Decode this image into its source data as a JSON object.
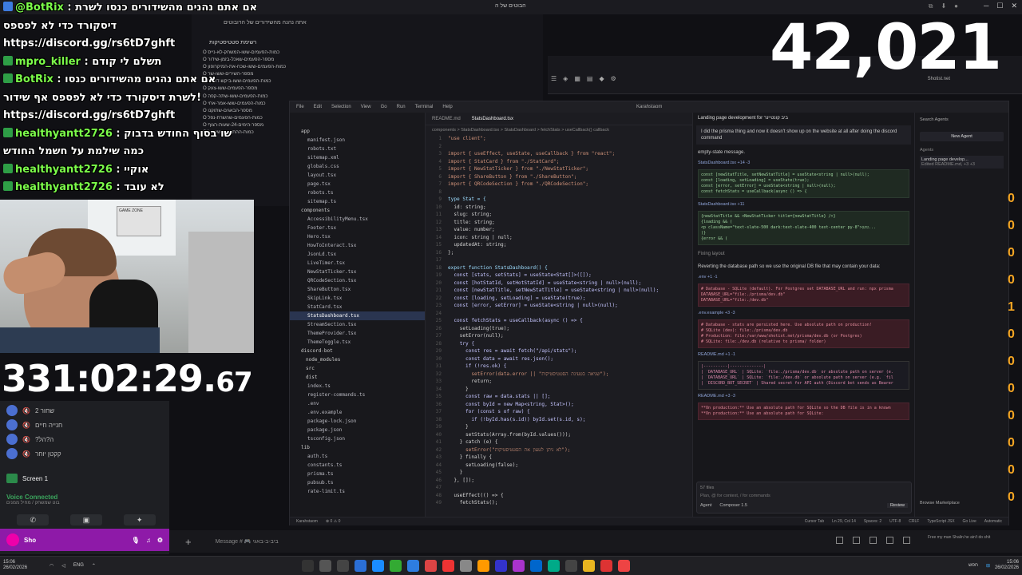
{
  "viewer_count": "42,021",
  "timer": {
    "main": "331:02:29.",
    "ms": "67"
  },
  "browser_top": {
    "title": "הבוטים של ה",
    "right_label": "Shotist.net"
  },
  "chat": [
    {
      "name": "@BotRix",
      "text": ": אם אתם נהנים מהשידורים כנסו לשרת",
      "badge": "blue"
    },
    {
      "name": "",
      "text": "דיסקורד כדי לא לפספס",
      "badge": "none"
    },
    {
      "name": "",
      "text": "https://discord.gg/rs6tD7ghft",
      "badge": "none"
    },
    {
      "name": "mpro_killer",
      "text": ": תשלם לי קודם",
      "badge": "green"
    },
    {
      "name": "BotRix",
      "text": ": אם אתם נהנים מהשידורים כנסו",
      "badge": "green"
    },
    {
      "name": "",
      "text": "לשרת דיסקורד כדי לא לפספס אף שידור!",
      "badge": "none"
    },
    {
      "name": "",
      "text": "https://discord.gg/rs6tD7ghft",
      "badge": "none"
    },
    {
      "name": "healthyantt2726",
      "text": ": שו בסוף החודש בדבוק",
      "badge": "green"
    },
    {
      "name": "",
      "text": "כמה שילמת על חשמל החודש",
      "badge": "none"
    },
    {
      "name": "healthyantt2726",
      "text": ": אוקיי",
      "badge": "green"
    },
    {
      "name": "healthyantt2726",
      "text": ": לא עובד",
      "badge": "green"
    }
  ],
  "bg_browser": {
    "tab": "אתה נהנה מהשידורים של הרובוטים",
    "title": "רשימת סטטיסטיקות",
    "items": [
      "כמות-הפעמים-ששו-המשחק-לא-נייס",
      "מספר-הפעמים-שאכל-בזמן-שידור",
      "כמות-הפעמים-ששו-שכח-את-המיקרופון",
      "מספר-השירים-ששו-שר",
      "כמות-הפעמים-ששו-ביקש-דונייט",
      "מספר-הפעמים-ששו-צעק",
      "כמות-הפעמים-ששו-שתה-קפה",
      "כמות-הפעמים-ששו-אמר-אחי",
      "מספר-הבאגים-שתוקנו",
      "כמות-הפעמים-שהשרת-נפל",
      "מספר-הימים-24-שעות-רצוף",
      "כמות-ההתראות-שקיבל"
    ]
  },
  "webcam": {
    "sign": "GAME ZONE"
  },
  "discord": {
    "voice_users": [
      "שחור 2",
      "חנייה חיים",
      "?ה?הל",
      "קקטן יוחר"
    ],
    "screen_label": "Screen 1",
    "voice_title": "Voice Connected",
    "voice_sub": "בוט שמשחק / מחיל ממנים",
    "user": "Sho"
  },
  "ide": {
    "title": "Karahstaom",
    "menu": [
      "File",
      "Edit",
      "Selection",
      "View",
      "Go",
      "Run",
      "Terminal",
      "Help"
    ],
    "tree": [
      "app",
      "manifest.json",
      "robots.txt",
      "sitemap.xml",
      "globals.css",
      "layout.tsx",
      "page.tsx",
      "robots.ts",
      "sitemap.ts",
      "components",
      "AccessibilityMenu.tsx",
      "Footer.tsx",
      "Hero.tsx",
      "HowToInteract.tsx",
      "JsonLd.tsx",
      "LiveTimer.tsx",
      "NewStatTicker.tsx",
      "QRCodeSection.tsx",
      "ShareButton.tsx",
      "SkipLink.tsx",
      "StatCard.tsx",
      "StatsDashboard.tsx",
      "StreamSection.tsx",
      "ThemeProvider.tsx",
      "ThemeToggle.tsx",
      "discord-bot",
      "node_modules",
      "src",
      "dist",
      "index.ts",
      "register-commands.ts",
      ".env",
      ".env.example",
      "package-lock.json",
      "package.json",
      "tsconfig.json",
      "lib",
      "auth.ts",
      "constants.ts",
      "prisma.ts",
      "pubsub.ts",
      "rate-limit.ts"
    ],
    "tabs": [
      "README.md",
      "StatsDashboard.tsx"
    ],
    "breadcrumb": "components > StatsDashboard.tsx > StatsDashboard > fetchStats > useCallback() callback",
    "code": [
      "\"use client\";",
      "",
      "import { useEffect, useState, useCallback } from \"react\";",
      "import { StatCard } from \"./StatCard\";",
      "import { NewStatTicker } from \"./NewStatTicker\";",
      "import { ShareButton } from \"./ShareButton\";",
      "import { QRCodeSection } from \"./QRCodeSection\";",
      "",
      "type Stat = {",
      "  id: string;",
      "  slug: string;",
      "  title: string;",
      "  value: number;",
      "  icon: string | null;",
      "  updatedAt: string;",
      "};",
      "",
      "export function StatsDashboard() {",
      "  const [stats, setStats] = useState<Stat[]>([]);",
      "  const [hotStatId, setHotStatId] = useState<string | null>(null);",
      "  const [newStatTitle, setNewStatTitle] = useState<string | null>(null);",
      "  const [loading, setLoading] = useState(true);",
      "  const [error, setError] = useState<string | null>(null);",
      "",
      "  const fetchStats = useCallback(async () => {",
      "    setLoading(true);",
      "    setError(null);",
      "    try {",
      "      const res = await fetch(\"/api/stats\");",
      "      const data = await res.json();",
      "      if (!res.ok) {",
      "        setError(data.error || \"שגיאה בטעינת הסטטיסטיקות\");",
      "        return;",
      "      }",
      "      const raw = data.stats || [];",
      "      const byId = new Map<string, Stat>();",
      "      for (const s of raw) {",
      "        if (!byId.has(s.id)) byId.set(s.id, s);",
      "      }",
      "      setStats(Array.from(byId.values()));",
      "    } catch (e) {",
      "      setError(\"לא ניתן לטעון את הסטטיסטיקות\");",
      "    } finally {",
      "      setLoading(false);",
      "    }",
      "  }, []);",
      "",
      "  useEffect(() => {",
      "    fetchStats();"
    ],
    "chat": {
      "header": "Landing page development for ביב קונטיינר",
      "user_msg": "I did the prisma thing and now it doesn't show up on the website at all after doing the discord command",
      "empty_state": "empty-state message.",
      "file1": "StatsDashboard.tsx +14 -3",
      "code1": [
        "const [newStatTitle, setNewStatTitle] = useState<string | null>(null);",
        "const [loading, setLoading] = useState(true);",
        "const [error, setError] = useState<string | null>(null);",
        "const fetchStats = useCallback(async () => {"
      ],
      "file2": "StatsDashboard.tsx +11",
      "code2": [
        "{newStatTitle && <NewStatTicker title={newStatTitle} />}",
        "{loading && (",
        "  <p className=\"text-slate-500 dark:text-slate-400 text-center py-8\">טוען...",
        ")}",
        "{error && ("
      ],
      "fixing": "Fixing layout",
      "reverting": "Reverting the database path so we use the original DB file that may contain your data:",
      "file3": ".env +1 -1",
      "code3": [
        "# Database - SQLite (default). For Postgres set DATABASE_URL and run: npx prisma",
        "DATABASE_URL=\"file:./prisma/dev.db\"",
        "DATABASE_URL=\"file:./dev.db\""
      ],
      "file4": ".env.example +3 -3",
      "code4": [
        "# Database - stats are persisted here. Use absolute path on production!",
        "# SQLite (dev): file:./prisma/dev.db",
        "# Production: file:/var/www/shotist.net/prisma/dev.db (or Postgres)",
        "# SQLite: file:./dev.db (relative to prisma/ folder)"
      ],
      "file5": "README.md +1 -1",
      "code5": [
        "|----------|--------------|",
        "| `DATABASE_URL` | SQLite: `file:./prisma/dev.db` or absolute path on server (e.",
        "| `DATABASE_URL` | SQLite: `file:./dev.db` or absolute path on server (e.g. `fil",
        "| `DISCORD_BOT_SECRET` | Shared secret for API auth (Discord bot sends as Bearer"
      ],
      "file6": "README.md +3 -3",
      "code6": [
        "**On production:** Use an absolute path for SQLite so the DB file is in a known",
        "**On production:** Use an absolute path for SQLite:"
      ],
      "files_count": "57 files",
      "review": "Review",
      "input_placeholder": "Plan, @ for context, / for commands",
      "agent": "Agent",
      "model": "Composer 1.5"
    },
    "agents": {
      "search": "Search Agents",
      "new_agent": "New Agent",
      "label": "Agents",
      "item": "Landing page develop...",
      "item_sub": "Edited README.md, +3 +3",
      "browse": "Browse Marketplace"
    },
    "status_left": [
      "Karahstaom",
      "⊗ 0 ⚠ 0"
    ],
    "status_right": [
      "Cursor Tab",
      "Ln 29, Col 14",
      "Spaces: 2",
      "UTF-8",
      "CRLF",
      "TypeScript JSX",
      "Go Live",
      "Automatic"
    ]
  },
  "msgbar": {
    "placeholder": "Message # 🎮 ביב-ב-באגי",
    "ad": "Free my man Shalin he ain't do shit"
  },
  "taskbar": {
    "weather": "21°C",
    "date_left": "26/02/2026",
    "lang": "ENG",
    "time": "15:06",
    "date_right": "26/02/2026",
    "lang_right": "חפש"
  }
}
